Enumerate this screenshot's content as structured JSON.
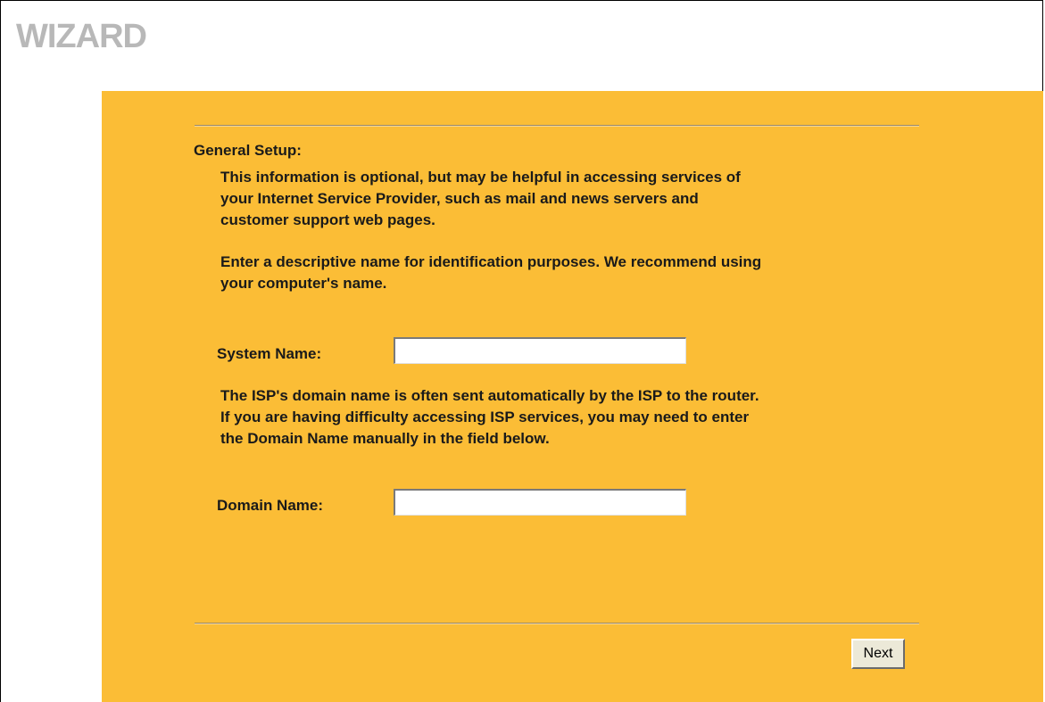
{
  "header": {
    "title": "WIZARD"
  },
  "form": {
    "section_title": "General Setup:",
    "intro_lines": [
      "This information is optional, but may be helpful in accessing services of",
      "your Internet Service Provider, such as mail and news servers and",
      "customer support web pages."
    ],
    "name_hint_lines": [
      "Enter a descriptive name for identification purposes. We recommend using",
      "your computer's name."
    ],
    "system_name_label": "System Name:",
    "system_name_value": "",
    "domain_hint_lines": [
      "The ISP's domain name is often sent automatically by the ISP to the router.",
      "If you are having difficulty accessing ISP services, you may need to enter",
      "the Domain Name manually in the field below."
    ],
    "domain_name_label": "Domain Name:",
    "domain_name_value": ""
  },
  "buttons": {
    "next_label": "Next"
  },
  "colors": {
    "panel_background": "#fbbd36",
    "title_gray": "#b8b8b8"
  }
}
